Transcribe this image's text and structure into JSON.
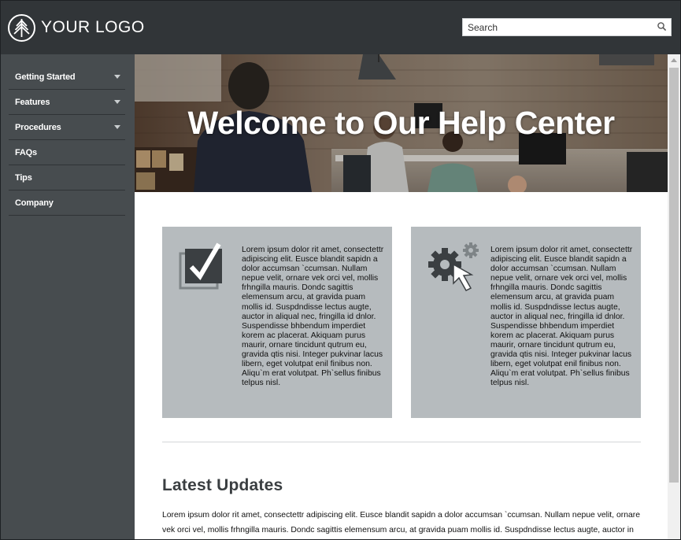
{
  "header": {
    "logo_text": "YOUR LOGO",
    "search": {
      "placeholder": "Search",
      "value": ""
    }
  },
  "sidebar": {
    "items": [
      {
        "label": "Getting Started",
        "has_submenu": true
      },
      {
        "label": "Features",
        "has_submenu": true
      },
      {
        "label": "Procedures",
        "has_submenu": true
      },
      {
        "label": "FAQs",
        "has_submenu": false
      },
      {
        "label": "Tips",
        "has_submenu": false
      },
      {
        "label": "Company",
        "has_submenu": false
      }
    ]
  },
  "hero": {
    "title": "Welcome to Our Help Center"
  },
  "cards": [
    {
      "icon": "checkbox-icon",
      "text": "Lorem ipsum dolor rit amet, consectettr adipiscing elit. Eusce blandit sapidn a dolor accumsan `ccumsan. Nullam nepue velit, ornare vek orci vel, mollis frhngilla mauris. Dondc sagittis elemensum arcu, at gravida puam mollis id. Suspdndisse lectus augte, auctor in aliqual nec, fringilla id dnlor. Suspendisse bhbendum imperdiet korem ac placerat. Akiquam purus maurir, ornare tincidunt qutrum eu, gravida qtis nisi. Integer pukvinar lacus libern, eget volutpat enil finibus non. Aliqu`m erat volutpat. Ph`sellus finibus telpus nisl."
    },
    {
      "icon": "settings-cursor-icon",
      "text": "Lorem ipsum dolor rit amet, consectettr adipiscing elit. Eusce blandit sapidn a dolor accumsan `ccumsan. Nullam nepue velit, ornare vek orci vel, mollis frhngilla mauris. Dondc sagittis elemensum arcu, at gravida puam mollis id. Suspdndisse lectus augte, auctor in aliqual nec, fringilla id dnlor. Suspendisse bhbendum imperdiet korem ac placerat. Akiquam purus maurir, ornare tincidunt qutrum eu, gravida qtis nisi. Integer pukvinar lacus libern, eget volutpat enil finibus non. Aliqu`m erat volutpat. Ph`sellus finibus telpus nisl."
    }
  ],
  "updates": {
    "heading": "Latest Updates",
    "text": "Lorem ipsum dolor rit amet, consectettr adipiscing elit. Eusce blandit sapidn a dolor accumsan `ccumsan. Nullam nepue velit, ornare vek orci vel, mollis frhngilla mauris. Dondc sagittis elemensum arcu, at gravida puam mollis id. Suspdndisse lectus augte, auctor in aliqual nec, fringilla id dnlor. Suspendisse bhbendum imperdiet korem ac placerat. Akiquam purus maurir, ornare tincidunt qutrum eu, gravida qtis nisi."
  },
  "colors": {
    "header_bg": "#313538",
    "sidebar_bg": "#474c4f",
    "card_bg": "#b6bbbe",
    "icon_dark": "#3b3f42"
  }
}
